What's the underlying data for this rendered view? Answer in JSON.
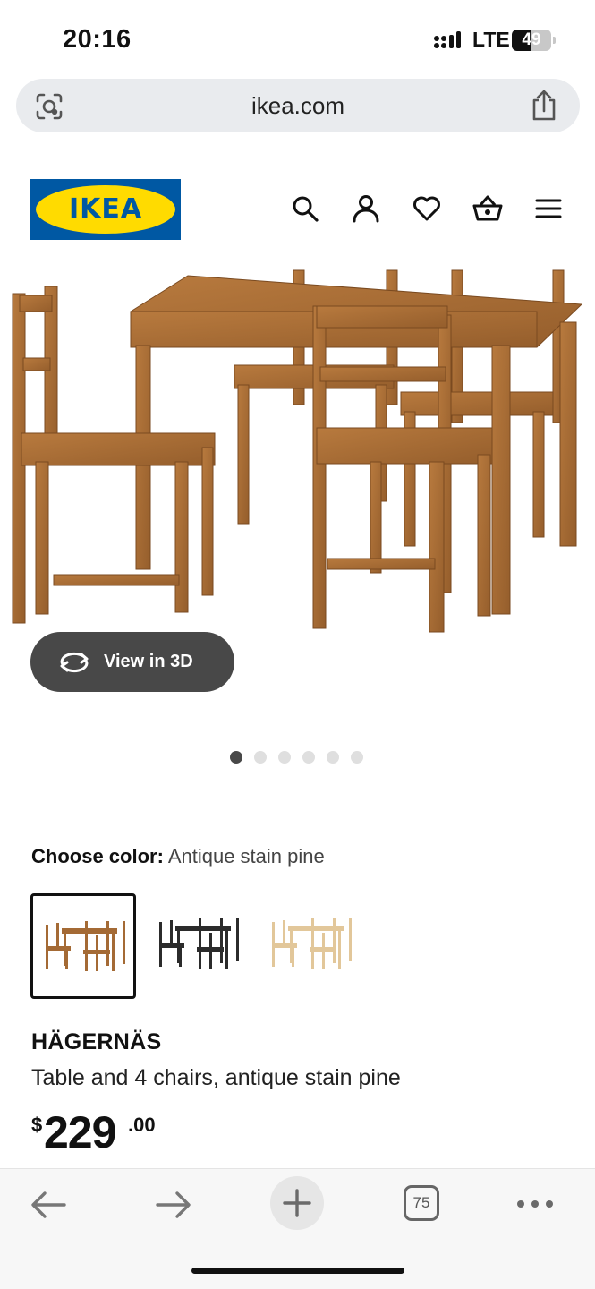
{
  "status_bar": {
    "time": "20:16",
    "network": "LTE",
    "battery": "49",
    "battery_level": 0.49
  },
  "browser": {
    "url": "ikea.com",
    "tab_count": "75"
  },
  "header": {
    "logo_text": "IKEA",
    "logo_colors": {
      "blue": "#0058a3",
      "yellow": "#ffdb00"
    }
  },
  "icons": {
    "header": [
      "search-icon",
      "account-icon",
      "heart-icon",
      "basket-icon",
      "menu-icon"
    ],
    "toolbar": [
      "back-arrow-icon",
      "forward-arrow-icon",
      "plus-icon",
      "tabs-icon",
      "more-icon"
    ]
  },
  "gallery": {
    "view3d_label": "View in 3D",
    "image_count": 6,
    "active_index": 0
  },
  "color_picker": {
    "label": "Choose color:",
    "selected_value": "Antique stain pine",
    "options": [
      {
        "name": "antique-stain-pine",
        "color": "#a46a35"
      },
      {
        "name": "black-brown",
        "color": "#2b2b2b"
      },
      {
        "name": "pine",
        "color": "#e2c79a"
      }
    ]
  },
  "product": {
    "name": "HÄGERNÄS",
    "description": "Table and 4 chairs, antique stain pine",
    "price_currency": "$",
    "price_integer": "229",
    "price_decimal": ".00"
  }
}
